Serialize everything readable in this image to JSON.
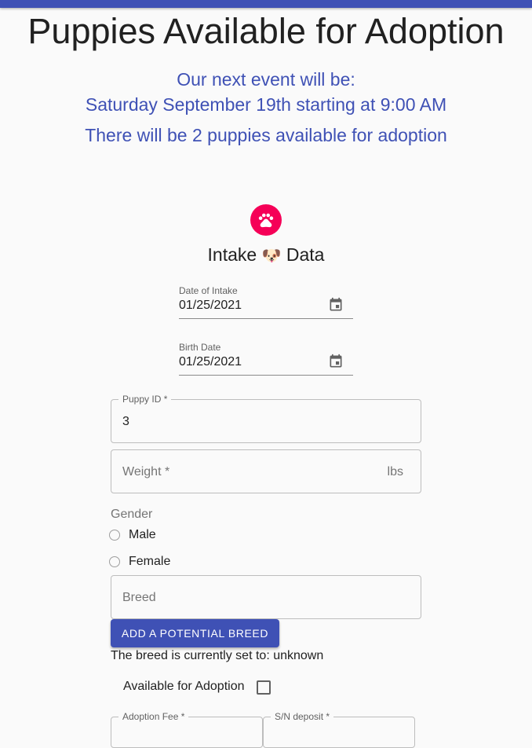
{
  "header": {
    "title": "Puppies Available for Adoption",
    "event_line1": "Our next event will be:",
    "event_line2": "Saturday September 19th starting at 9:00 AM",
    "event_line3": "There will be 2 puppies available for adoption"
  },
  "form": {
    "avatar_icon": "paw-icon",
    "title_before": "Intake",
    "title_emoji": "🐶",
    "title_after": "Data",
    "date_of_intake": {
      "label": "Date of Intake",
      "value": "01/25/2021",
      "icon": "calendar-icon"
    },
    "birth_date": {
      "label": "Birth Date",
      "value": "01/25/2021",
      "icon": "calendar-icon"
    },
    "puppy_id": {
      "label": "Puppy ID *",
      "value": "3"
    },
    "weight": {
      "placeholder": "Weight *",
      "unit": "lbs"
    },
    "gender": {
      "label": "Gender",
      "options": [
        "Male",
        "Female"
      ]
    },
    "breed": {
      "placeholder": "Breed"
    },
    "add_breed_button": "ADD A POTENTIAL BREED",
    "breed_status": "The breed is currently set to: unknown",
    "available_label": "Available for Adoption",
    "adoption_fee": {
      "label": "Adoption Fee *"
    },
    "sn_deposit": {
      "label": "S/N deposit *"
    }
  },
  "colors": {
    "primary": "#3f51b5",
    "secondary": "#f50057"
  }
}
